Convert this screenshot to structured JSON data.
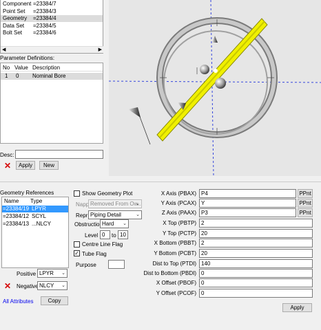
{
  "elements_list": [
    {
      "name": "Component",
      "value": "=23384/7"
    },
    {
      "name": "Point Set",
      "value": "=23384/3"
    },
    {
      "name": "Geometry",
      "value": "=23384/4"
    },
    {
      "name": "Data Set",
      "value": "=23384/5"
    },
    {
      "name": "Bolt Set",
      "value": "=23384/6"
    }
  ],
  "param_defs": {
    "title": "Parameter Definitions:",
    "headers": [
      "No",
      "Value",
      "Description"
    ],
    "rows": [
      [
        "1",
        "0",
        "Nominal Bore"
      ]
    ]
  },
  "desc_label": "Desc:",
  "desc_value": "",
  "apply_label": "Apply",
  "new_label": "New",
  "geom_refs": {
    "title": "Geometry References",
    "headers": [
      "Name",
      "Type"
    ],
    "rows": [
      [
        "=23384/19",
        "LPYR"
      ],
      [
        "=23384/12",
        "SCYL"
      ],
      [
        "=23384/13",
        "...NLCY"
      ]
    ]
  },
  "positive_label": "Positive",
  "positive_value": "LPYR",
  "negative_label": "Negative",
  "negative_value": "NLCY",
  "all_attributes": "All Attributes",
  "copy_label": "Copy",
  "show_geometry_plot": "Show Geometry Plot",
  "napp_label": "Napp",
  "napp_value": "Removed From Ow...",
  "repr_label": "Repr",
  "repr_value": "Piping Detail",
  "obstruction_label": "Obstruction",
  "obstruction_value": "Hard",
  "level_label": "Level",
  "level_from": "0",
  "level_to_label": "to",
  "level_to": "10",
  "centre_line_flag": "Centre Line Flag",
  "tube_flag": "Tube Flag",
  "purpose_label": "Purpose",
  "purpose_value": "",
  "fields": [
    {
      "label": "X Axis (PBAX)",
      "value": "P4",
      "pnt": "PPnt"
    },
    {
      "label": "Y Axis (PCAX)",
      "value": "Y",
      "pnt": "PPnt"
    },
    {
      "label": "Z Axis (PAAX)",
      "value": "P3",
      "pnt": "PPnt"
    },
    {
      "label": "X Top (PBTP)",
      "value": "2"
    },
    {
      "label": "Y Top (PCTP)",
      "value": "20"
    },
    {
      "label": "X Bottom (PBBT)",
      "value": "2"
    },
    {
      "label": "Y Bottom (PCBT)",
      "value": "20"
    },
    {
      "label": "Dist to Top (PTDI)",
      "value": "140"
    },
    {
      "label": "Dist to Bottom (PBDI)",
      "value": "0"
    },
    {
      "label": "X Offset (PBOF)",
      "value": "0"
    },
    {
      "label": "Y Offset (PCOF)",
      "value": "0"
    }
  ],
  "apply2_label": "Apply",
  "colors": {
    "selection": "#3399ff",
    "yellow_bar": "#f0f000",
    "viewport_bg": "#e6e6e6",
    "axis": "#3344dd"
  }
}
